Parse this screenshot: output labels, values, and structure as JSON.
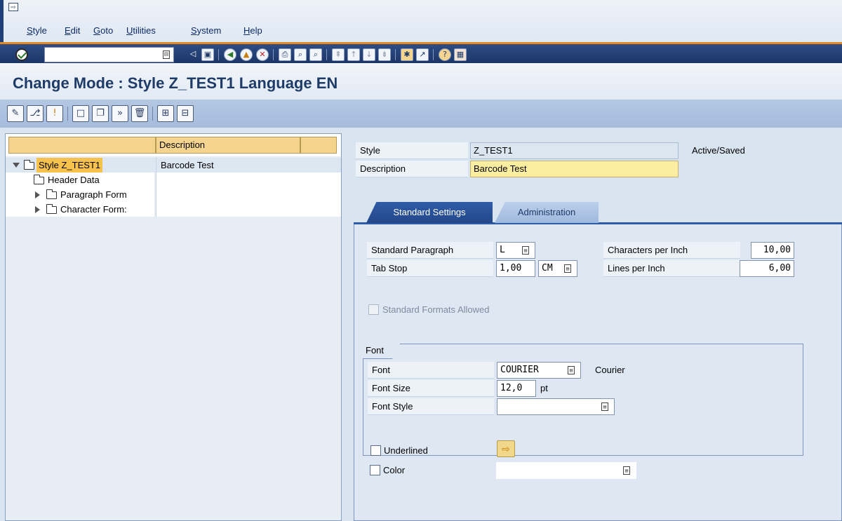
{
  "menubar": {
    "items": [
      {
        "label": "Style",
        "u": "S",
        "rest": "tyle"
      },
      {
        "label": "Edit",
        "u": "E",
        "rest": "dit"
      },
      {
        "label": "Goto",
        "u": "G",
        "rest": "oto"
      },
      {
        "label": "Utilities",
        "u": "U",
        "rest": "tilities"
      },
      {
        "label": "System",
        "u": "S",
        "rest": "ystem"
      },
      {
        "label": "Help",
        "u": "H",
        "rest": "elp"
      }
    ]
  },
  "toolbar": {
    "command_value": ""
  },
  "title": "Change Mode : Style Z_TEST1 Language EN",
  "tree": {
    "header_description": "Description",
    "rows": [
      {
        "label": "Style Z_TEST1",
        "description": "Barcode Test",
        "expanded": true,
        "selected": true
      },
      {
        "label": "Header Data",
        "description": ""
      },
      {
        "label": "Paragraph Form",
        "description": ""
      },
      {
        "label": "Character Form:",
        "description": ""
      }
    ]
  },
  "detail": {
    "style_label": "Style",
    "style_value": "Z_TEST1",
    "status": "Active/Saved",
    "description_label": "Description",
    "description_value": "Barcode Test",
    "tabs": {
      "standard": "Standard Settings",
      "admin": "Administration"
    },
    "std_paragraph_label": "Standard Paragraph",
    "std_paragraph_value": "L",
    "tab_stop_label": "Tab Stop",
    "tab_stop_value": "1,00",
    "tab_stop_unit": "CM",
    "cpi_label": "Characters per Inch",
    "cpi_value": "10,00",
    "lpi_label": "Lines per Inch",
    "lpi_value": "6,00",
    "std_formats_label": "Standard Formats Allowed",
    "font_group": {
      "title": "Font",
      "font_label": "Font",
      "font_value": "COURIER",
      "font_desc": "Courier",
      "size_label": "Font Size",
      "size_value": "12,0",
      "size_unit": "pt",
      "style_label": "Font Style",
      "style_value": "",
      "underlined_label": "Underlined",
      "color_label": "Color",
      "color_value": ""
    }
  }
}
